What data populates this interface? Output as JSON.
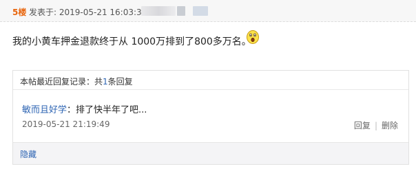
{
  "post": {
    "floor": "5楼",
    "meta_prefix": "发表于: 2019-05-21 16:03:31",
    "meta_sep": "›",
    "content": "我的小黄车押金退款终于从 1000万排到了800多万名。"
  },
  "icons": {
    "emoji": "surprised-face-icon"
  },
  "reply_box": {
    "header_prefix": "本帖最近回复记录：共",
    "count": "1",
    "header_suffix": "条回复",
    "items": [
      {
        "user": "敏而且好学",
        "text": "：排了快半年了吧...",
        "time": "2019-05-21  21:19:49",
        "reply_label": "回复",
        "separator": "|",
        "delete_label": "删除"
      }
    ],
    "hide_label": "隐藏"
  },
  "colors": {
    "floor": "#e8650d",
    "link": "#2d64b3",
    "header_bg": "#f7f7f7"
  }
}
